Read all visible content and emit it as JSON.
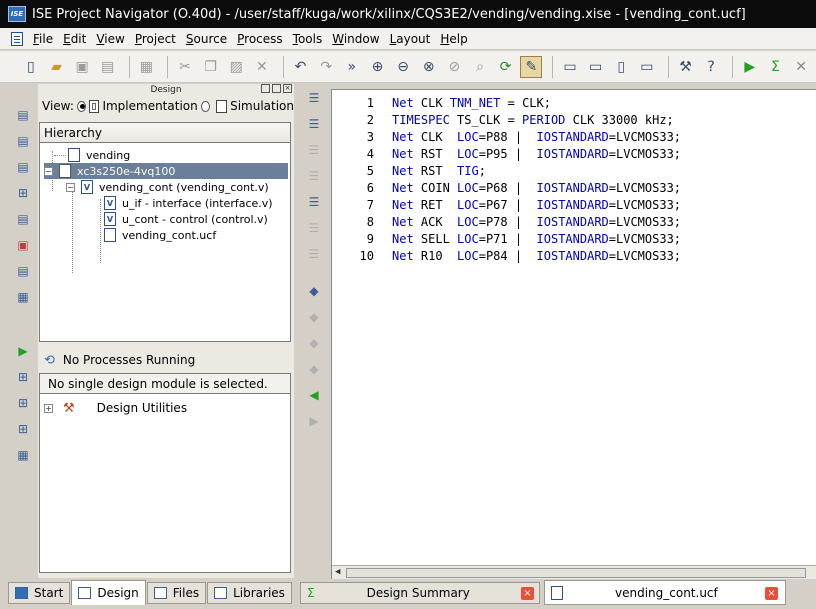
{
  "window": {
    "title": "ISE Project Navigator (O.40d) - /user/staff/kuga/work/xilinx/CQS3E2/vending/vending.xise - [vending_cont.ucf]",
    "logo": "ISE"
  },
  "menu": [
    "File",
    "Edit",
    "View",
    "Project",
    "Source",
    "Process",
    "Tools",
    "Window",
    "Layout",
    "Help"
  ],
  "design_panel": {
    "header": "Design",
    "view_label": "View:",
    "view_options": [
      "Implementation",
      "Simulation"
    ],
    "view_selected": "Implementation",
    "hierarchy_title": "Hierarchy",
    "tree": [
      {
        "label": "vending",
        "icon": "project-icon"
      },
      {
        "label": "xc3s250e-4vq100",
        "icon": "chip-icon",
        "selected": true
      },
      {
        "label": "vending_cont (vending_cont.v)",
        "icon": "verilog-top-icon"
      },
      {
        "label": "u_if - interface (interface.v)",
        "icon": "verilog-icon"
      },
      {
        "label": "u_cont - control (control.v)",
        "icon": "verilog-icon"
      },
      {
        "label": "vending_cont.ucf",
        "icon": "ucf-icon"
      }
    ],
    "process_status": "No Processes Running",
    "process_title": "No single design module is selected.",
    "process_items": [
      {
        "label": "Design Utilities",
        "icon": "tools-icon"
      }
    ]
  },
  "editor": {
    "lines": [
      [
        {
          "t": "Net",
          "k": 1
        },
        {
          "t": " CLK "
        },
        {
          "t": "TNM_NET",
          "k": 1
        },
        {
          "t": " = CLK;"
        }
      ],
      [
        {
          "t": "TIMESPEC",
          "k": 1
        },
        {
          "t": " TS_CLK = "
        },
        {
          "t": "PERIOD",
          "k": 1
        },
        {
          "t": " CLK 33000 kHz;"
        }
      ],
      [
        {
          "t": "Net",
          "k": 1
        },
        {
          "t": " CLK  "
        },
        {
          "t": "LOC",
          "k": 1
        },
        {
          "t": "=P88 |  "
        },
        {
          "t": "IOSTANDARD",
          "k": 1
        },
        {
          "t": "=LVCMOS33;"
        }
      ],
      [
        {
          "t": "Net",
          "k": 1
        },
        {
          "t": " RST  "
        },
        {
          "t": "LOC",
          "k": 1
        },
        {
          "t": "=P95 |  "
        },
        {
          "t": "IOSTANDARD",
          "k": 1
        },
        {
          "t": "=LVCMOS33;"
        }
      ],
      [
        {
          "t": "Net",
          "k": 1
        },
        {
          "t": " RST  "
        },
        {
          "t": "TIG",
          "k": 1
        },
        {
          "t": ";"
        }
      ],
      [
        {
          "t": "Net",
          "k": 1
        },
        {
          "t": " COIN "
        },
        {
          "t": "LOC",
          "k": 1
        },
        {
          "t": "=P68 |  "
        },
        {
          "t": "IOSTANDARD",
          "k": 1
        },
        {
          "t": "=LVCMOS33;"
        }
      ],
      [
        {
          "t": "Net",
          "k": 1
        },
        {
          "t": " RET  "
        },
        {
          "t": "LOC",
          "k": 1
        },
        {
          "t": "=P67 |  "
        },
        {
          "t": "IOSTANDARD",
          "k": 1
        },
        {
          "t": "=LVCMOS33;"
        }
      ],
      [
        {
          "t": "Net",
          "k": 1
        },
        {
          "t": " ACK  "
        },
        {
          "t": "LOC",
          "k": 1
        },
        {
          "t": "=P78 |  "
        },
        {
          "t": "IOSTANDARD",
          "k": 1
        },
        {
          "t": "=LVCMOS33;"
        }
      ],
      [
        {
          "t": "Net",
          "k": 1
        },
        {
          "t": " SELL "
        },
        {
          "t": "LOC",
          "k": 1
        },
        {
          "t": "=P71 |  "
        },
        {
          "t": "IOSTANDARD",
          "k": 1
        },
        {
          "t": "=LVCMOS33;"
        }
      ],
      [
        {
          "t": "Net",
          "k": 1
        },
        {
          "t": " R10  "
        },
        {
          "t": "LOC",
          "k": 1
        },
        {
          "t": "=P84 |  "
        },
        {
          "t": "IOSTANDARD",
          "k": 1
        },
        {
          "t": "=LVCMOS33;"
        }
      ]
    ],
    "keyword_color": "#0000c0"
  },
  "left_tabs": [
    "Start",
    "Design",
    "Files",
    "Libraries"
  ],
  "left_tab_active": "Design",
  "right_tabs": {
    "summary": "Design Summary",
    "file": "vending_cont.ucf"
  },
  "colors": {
    "titlebar": "#0c0c0c",
    "selection": "#6b7e9a",
    "close": "#e8503a"
  }
}
